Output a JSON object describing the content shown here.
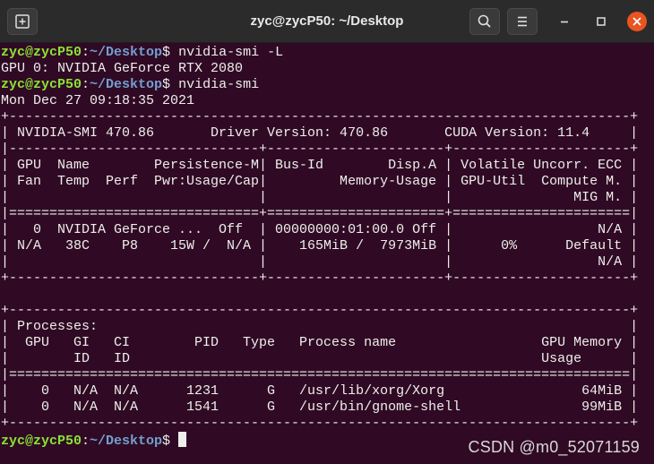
{
  "window": {
    "title": "zyc@zycP50: ~/Desktop",
    "icons": {
      "new_tab": "new-tab-icon",
      "search": "search-icon",
      "menu": "hamburger-menu-icon",
      "minimize": "minimize-icon",
      "maximize": "maximize-icon",
      "close": "close-icon"
    },
    "colors": {
      "background": "#300a24",
      "titlebar": "#2b2b2b",
      "prompt_user": "#8ae234",
      "prompt_path": "#729fcf",
      "close_button": "#e95420"
    }
  },
  "terminal": {
    "prompt": {
      "user_host": "zyc@zycP50",
      "colon": ":",
      "path": "~/Desktop",
      "symbol": "$ "
    },
    "cmd1": "nvidia-smi -L",
    "list_output": "GPU 0: NVIDIA GeForce RTX 2080",
    "cmd2": "nvidia-smi",
    "smi_lines": [
      "Mon Dec 27 09:18:35 2021",
      "+-----------------------------------------------------------------------------+",
      "| NVIDIA-SMI 470.86       Driver Version: 470.86       CUDA Version: 11.4     |",
      "|-------------------------------+----------------------+----------------------+",
      "| GPU  Name        Persistence-M| Bus-Id        Disp.A | Volatile Uncorr. ECC |",
      "| Fan  Temp  Perf  Pwr:Usage/Cap|         Memory-Usage | GPU-Util  Compute M. |",
      "|                               |                      |               MIG M. |",
      "|===============================+======================+======================|",
      "|   0  NVIDIA GeForce ...  Off  | 00000000:01:00.0 Off |                  N/A |",
      "| N/A   38C    P8    15W /  N/A |    165MiB /  7973MiB |      0%      Default |",
      "|                               |                      |                  N/A |",
      "+-------------------------------+----------------------+----------------------+",
      "",
      "+-----------------------------------------------------------------------------+",
      "| Processes:                                                                  |",
      "|  GPU   GI   CI        PID   Type   Process name                  GPU Memory |",
      "|        ID   ID                                                   Usage      |",
      "|=============================================================================|",
      "|    0   N/A  N/A      1231      G   /usr/lib/xorg/Xorg                 64MiB |",
      "|    0   N/A  N/A      1541      G   /usr/bin/gnome-shell               99MiB |",
      "+-----------------------------------------------------------------------------+"
    ],
    "cmd3": ""
  },
  "watermark": "CSDN @m0_52071159"
}
